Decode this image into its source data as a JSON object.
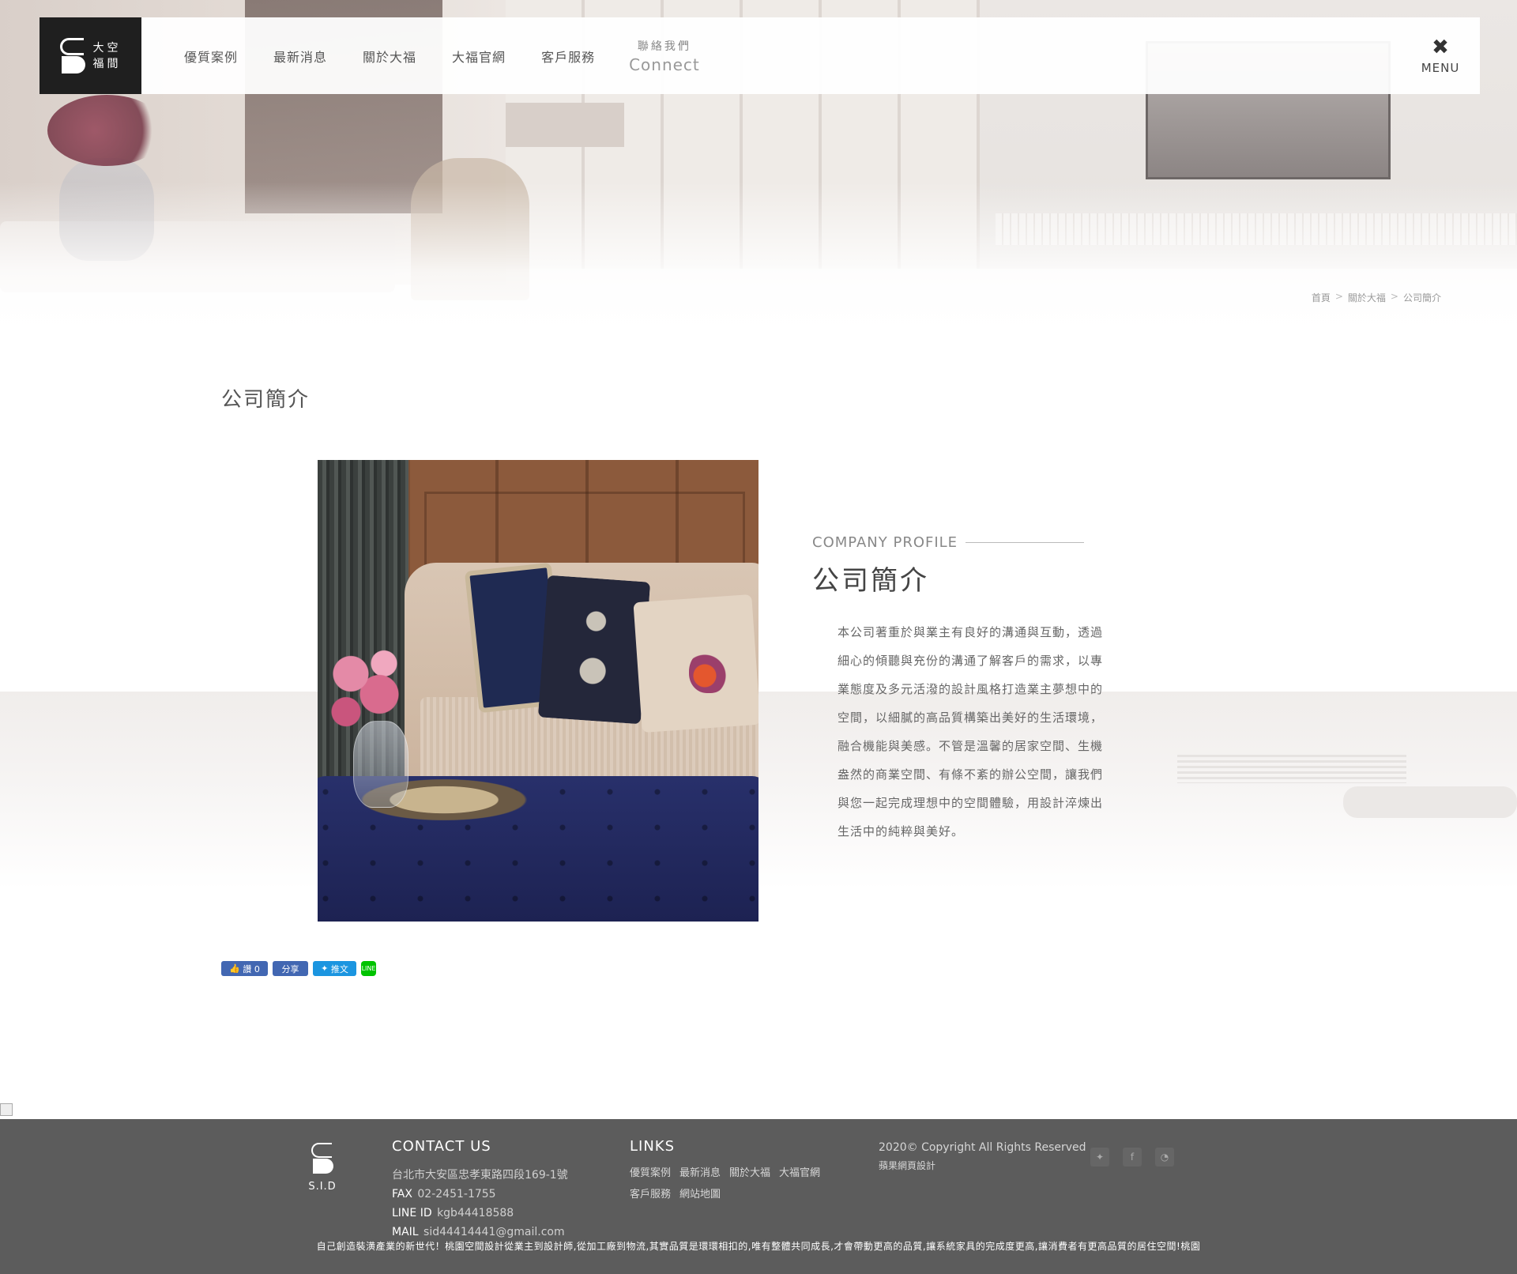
{
  "header": {
    "logo_line1": "大空",
    "logo_line2": "福間",
    "nav": [
      {
        "label": "優質案例"
      },
      {
        "label": "最新消息"
      },
      {
        "label": "關於大福"
      },
      {
        "label": "大福官網"
      },
      {
        "label": "客戶服務"
      }
    ],
    "contact_zh": "聯絡我們",
    "contact_en": "Connect",
    "menu_label": "MENU"
  },
  "breadcrumb": {
    "items": [
      "首頁",
      "關於大福",
      "公司簡介"
    ],
    "separator": ">"
  },
  "page_title": "公司簡介",
  "profile": {
    "label_en": "COMPANY PROFILE",
    "title": "公司簡介",
    "body": "本公司著重於與業主有良好的溝通與互動，透過細心的傾聽與充份的溝通了解客戶的需求，以專業態度及多元活潑的設計風格打造業主夢想中的空間，以細膩的高品質構築出美好的生活環境，融合機能與美感。不管是溫馨的居家空間、生機盎然的商業空間、有條不紊的辦公空間，讓我們與您一起完成理想中的空間體驗，用設計淬煉出生活中的純粹與美好。"
  },
  "share": {
    "like_label": "讚 0",
    "share_label": "分享",
    "tweet_label": "推文",
    "line_label": "LINE"
  },
  "footer": {
    "logo_name": "S.I.D",
    "contact_title": "CONTACT US",
    "address": "台北市大安區忠孝東路四段169-1號",
    "fax_key": "FAX",
    "fax": "02-2451-1755",
    "line_key": "LINE ID",
    "line_id": "kgb44418588",
    "mail_key": "MAIL",
    "mail": "sid44414441@gmail.com",
    "links_title": "LINKS",
    "links": [
      "優質案例",
      "最新消息",
      "關於大福",
      "大福官網",
      "客戶服務",
      "網站地圖"
    ],
    "copyright": "2020© Copyright All Rights Reserved",
    "designer": "蘋果網頁設計",
    "slogan": "自己創造裝潢產業的新世代！桃園空間設計從業主到設計師,從加工廠到物流,其實品質是環環相扣的,唯有整體共同成長,才會帶動更高的品質,讓系統家具的完成度更高,讓消費者有更高品質的居住空間!桃園"
  },
  "colors": {
    "footer_bg": "#5c5c5c",
    "logo_bg": "#1f1f1f",
    "fb_blue": "#4267b2",
    "twitter_blue": "#1b95e0",
    "line_green": "#00c300"
  }
}
